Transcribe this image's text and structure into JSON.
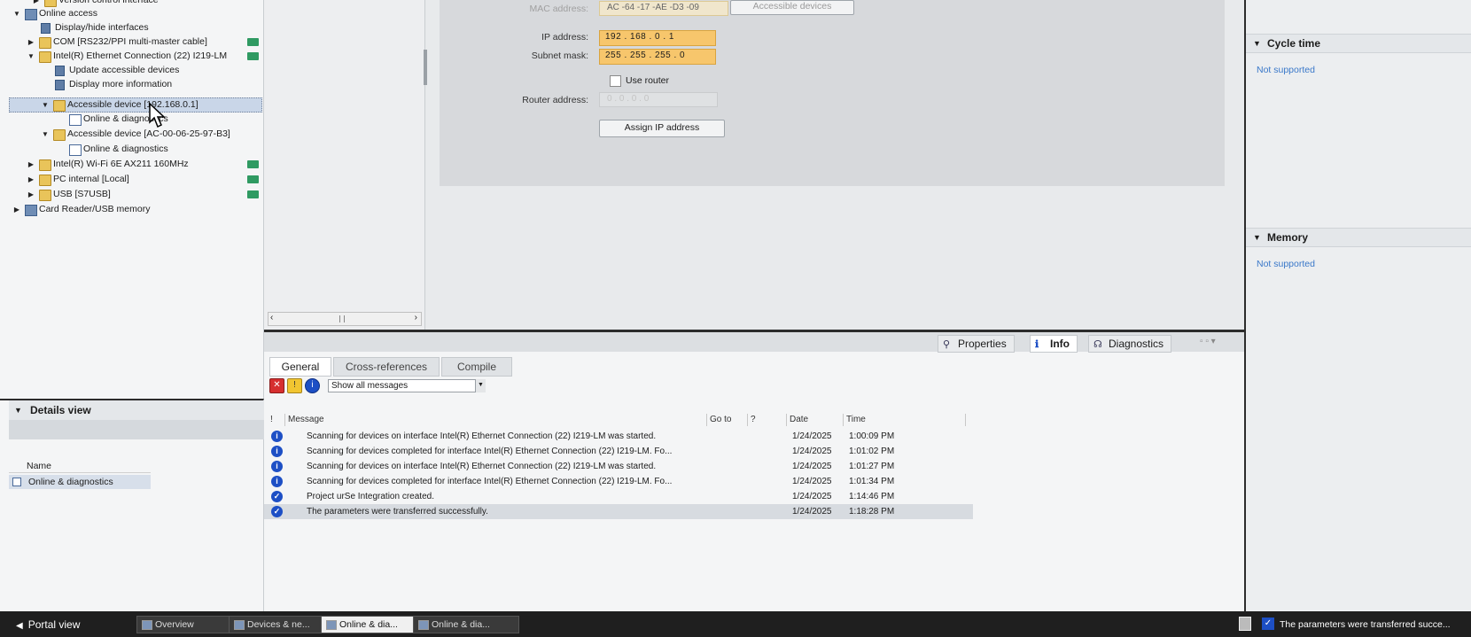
{
  "tree": {
    "items": [
      {
        "label": "Version control interface",
        "indent": 2
      },
      {
        "label": "Online access",
        "indent": 0
      },
      {
        "label": "Display/hide interfaces",
        "indent": 1
      },
      {
        "label": "COM [RS232/PPI multi-master cable]",
        "indent": 1
      },
      {
        "label": "Intel(R) Ethernet Connection (22) I219-LM",
        "indent": 1
      },
      {
        "label": "Update accessible devices",
        "indent": 2
      },
      {
        "label": "Display more information",
        "indent": 2
      },
      {
        "label": "Accessible device [192.168.0.1]",
        "indent": 2
      },
      {
        "label": "Online & diagnostics",
        "indent": 3
      },
      {
        "label": "Accessible device [AC-00-06-25-97-B3]",
        "indent": 2
      },
      {
        "label": "Online & diagnostics",
        "indent": 3
      },
      {
        "label": "Intel(R) Wi-Fi 6E AX211 160MHz",
        "indent": 1
      },
      {
        "label": "PC internal [Local]",
        "indent": 1
      },
      {
        "label": "USB [S7USB]",
        "indent": 1
      },
      {
        "label": "Card Reader/USB memory",
        "indent": 0
      }
    ]
  },
  "details": {
    "title": "Details view",
    "column_name": "Name",
    "row": "Online & diagnostics"
  },
  "form": {
    "mac_label": "MAC address:",
    "mac_value": "AC -64 -17 -AE -D3 -09",
    "accessible_button": "Accessible devices",
    "ip_label": "IP address:",
    "ip_value": "192 . 168 . 0 . 1",
    "subnet_label": "Subnet mask:",
    "subnet_value": "255 . 255 . 255 . 0",
    "use_router_label": "Use router",
    "router_label": "Router address:",
    "router_value": "0 . 0 . 0 . 0",
    "assign_button": "Assign IP address"
  },
  "right_panel": {
    "cycle_title": "Cycle time",
    "cycle_value": "Not supported",
    "memory_title": "Memory",
    "memory_value": "Not supported"
  },
  "inspector": {
    "tabs": [
      "Properties",
      "Info",
      "Diagnostics"
    ],
    "active_tab": "Info",
    "subtabs": [
      "General",
      "Cross-references",
      "Compile"
    ],
    "filter_value": "Show all messages",
    "columns": {
      "bang": "!",
      "message": "Message",
      "goto": "Go to",
      "q": "?",
      "date": "Date",
      "time": "Time"
    },
    "messages": [
      {
        "type": "info",
        "text": "Scanning for devices on interface Intel(R) Ethernet Connection (22) I219-LM was started.",
        "date": "1/24/2025",
        "time": "1:00:09 PM"
      },
      {
        "type": "info",
        "text": "Scanning for devices completed for interface Intel(R) Ethernet Connection (22) I219-LM. Fo...",
        "date": "1/24/2025",
        "time": "1:01:02 PM"
      },
      {
        "type": "info",
        "text": "Scanning for devices on interface Intel(R) Ethernet Connection (22) I219-LM was started.",
        "date": "1/24/2025",
        "time": "1:01:27 PM"
      },
      {
        "type": "info",
        "text": "Scanning for devices completed for interface Intel(R) Ethernet Connection (22) I219-LM. Fo...",
        "date": "1/24/2025",
        "time": "1:01:34 PM"
      },
      {
        "type": "success",
        "text": "Project urSe Integration created.",
        "date": "1/24/2025",
        "time": "1:14:46 PM"
      },
      {
        "type": "success",
        "text": "The parameters were transferred successfully.",
        "date": "1/24/2025",
        "time": "1:18:28 PM"
      }
    ]
  },
  "statusbar": {
    "portal": "Portal view",
    "tabs": [
      "Overview",
      "Devices & ne...",
      "Online & dia...",
      "Online & dia..."
    ],
    "status_message": "The parameters were transferred succe..."
  },
  "colors": {
    "accent": "#1d4fc5",
    "ip_highlight": "#f7c66c",
    "link": "#3a78c9"
  }
}
